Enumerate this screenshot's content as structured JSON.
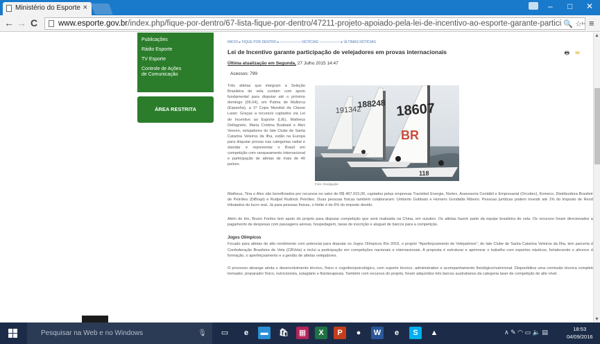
{
  "browser": {
    "tab_title": "Ministério do Esporte",
    "tab_close": "×",
    "url_host": "www.esporte.gov.br",
    "url_path": "/index.php/fique-por-dentro/67-lista-fique-por-dentro/47211-projeto-apoiado-pela-lei-de-incentivo-ao-esporte-garante-participacao-de-velejad",
    "win_minimize": "–",
    "win_maximize": "□",
    "win_close": "✕"
  },
  "sidebar": {
    "items": [
      "Publicações",
      "Rádio Esporte",
      "TV Esporte",
      "Controle de Ações de Comunicação"
    ],
    "restricted_label": "ÁREA RESTRITA"
  },
  "article": {
    "breadcrumb": "INÍCIO ▸ FIQUE POR DENTRO ▸ —————— NOTÍCIAS —————— ▸ ÚLTIMAS NOTÍCIAS",
    "title": "Lei de Incentivo garante participação de velejadores em provas internacionais",
    "updated_label": "Última atualização em Segunda,",
    "updated_date": "27 Julho 2015 14:47",
    "hits": "Acessos: 799",
    "intro": "Três atletas que integram a Seleção Brasileira de vela contam com apoio fundamental para disputar até o próximo domingo (06.04), em Palma de Mallorca (Espanha), a 1ª Copa Mundial da Classe Laser. Graças a recursos captados via Lei de Incentivo ao Esporte (LIE), Matheus Dellagnelo, Maria Cristina Boabaid e Alex Veeren, velejadores do Iate Clube de Santa Catarina Veleiros da Ilha, estão na Europa para disputar provas nas categorias radial e standar e representar o Brasil em competição com ranqueamento internacional e participação de atletas de mais de 40 países.",
    "photo_credit": "Foto: Divulgação",
    "sail_numbers": [
      "191342",
      "188248",
      "18607",
      "118"
    ],
    "para1": "Matheus, Tina e Alex são beneficiados por recursos no valor de R$ 467.915,00, captados pelas empresas Tractebel Energia, Nortex, Assessoria Contábil e Empresarial (Orcsitec), Komeco, Distribuidora Brasileira de Petróleo (DiBrapi) e Rudpel Rudnick Petróleo. Duas pessoas físicas também colaboraram: Umberto Gobbato e Homero Gorafallis Ribeiro. Pessoas jurídicas podem investir até 1% do Imposto de Renda tributados do lucro real. Já para pessoas físicas, o limite é de 6% do imposto devido.",
    "para2": "Além do trio, Bruno Fontes tem apoio do projeto para disputar competição que será realizada na China, em outubro. Os atletas fazem parte da equipe brasileira de vela. Os recursos foram direcionados ao pagamento de despesas com passagens aéreas, hospedagem, taxas de inscrição e aluguel de barcos para a competição.",
    "subhead": "Jogos Olímpicos",
    "para3": "Focado para atletas de alto rendimento com potencial para disputar os Jogos Olímpicos Rio 2016, o projeto \"Aperfeiçoamento de Velejadores\", do Iate Clube de Santa Catarina Veleiros da Ilha, tem parceria da Confederação Brasileira de Vela (CBVela) e inclui a participação em competições nacionais e internacionais. A proposta é estruturar e aprimorar o trabalho com esportes náuticos, fortalecendo o alicerce da formação, o aperfeiçoamento e a gestão de atletas velejadores.",
    "para4": "O processo abrange ainda o desenvolvimento técnico, físico e cognitivo/psicológico, com suporte técnico, administrativo e acompanhamento fisiológico/nutricional. Disponibiliza uma comissão técnica completa: treinador, preparador físico, nutricionista, estagiário e fisioterapeuta. Também com recursos do projeto, foram adquiridos três barcos australianos da categoria laser de competição de alto nível."
  },
  "taskbar": {
    "search_placeholder": "Pesquisar na Web e no Windows",
    "time": "18:53",
    "date": "04/09/2016",
    "apps": [
      {
        "name": "task-view",
        "glyph": "▭",
        "color": "#1c2c48"
      },
      {
        "name": "edge",
        "glyph": "e",
        "color": "#1c2c48"
      },
      {
        "name": "file-explorer",
        "glyph": "▬",
        "color": "#2a8fd6"
      },
      {
        "name": "store",
        "glyph": "🛍",
        "color": "#1c2c48"
      },
      {
        "name": "calendar",
        "glyph": "▦",
        "color": "#b4245a"
      },
      {
        "name": "excel",
        "glyph": "X",
        "color": "#1f7145"
      },
      {
        "name": "powerpoint",
        "glyph": "P",
        "color": "#c43e1c"
      },
      {
        "name": "chrome",
        "glyph": "●",
        "color": "#1c2c48"
      },
      {
        "name": "word",
        "glyph": "W",
        "color": "#2b579a"
      },
      {
        "name": "internet-explorer",
        "glyph": "e",
        "color": "#1c2c48"
      },
      {
        "name": "skype",
        "glyph": "S",
        "color": "#00aff0"
      },
      {
        "name": "photos",
        "glyph": "▲",
        "color": "#1c2c48"
      }
    ]
  }
}
